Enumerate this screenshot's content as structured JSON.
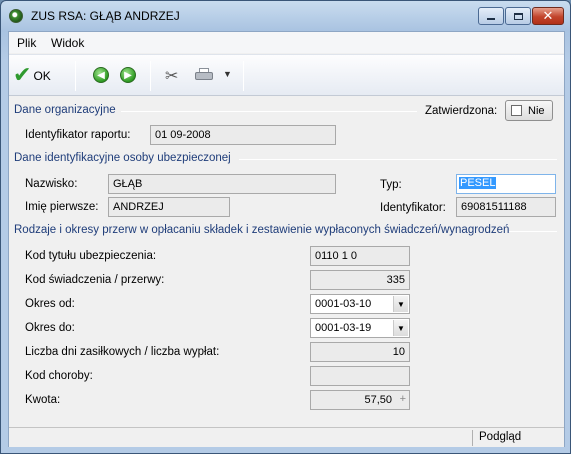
{
  "window": {
    "title": "ZUS RSA: GŁĄB ANDRZEJ",
    "icon": "app-icon",
    "controls": [
      "minimize-icon",
      "maximize-icon",
      "close-icon"
    ]
  },
  "menu": {
    "items": [
      "Plik",
      "Widok"
    ]
  },
  "toolbar": {
    "ok_label": "OK",
    "icons": [
      "ok-check-icon",
      "back-arrow-icon",
      "forward-arrow-icon",
      "tools-icon",
      "print-icon",
      "dropdown-arrow-icon"
    ]
  },
  "org_section": {
    "title": "Dane organizacyjne",
    "approved_label": "Zatwierdzona:",
    "approved_value": "Nie",
    "report_id_label": "Identyfikator raportu:",
    "report_id_value": "01 09-2008"
  },
  "person_section": {
    "title": "Dane identyfikacyjne osoby ubezpieczonej",
    "surname_label": "Nazwisko:",
    "surname_value": "GŁĄB",
    "firstname_label": "Imię pierwsze:",
    "firstname_value": "ANDRZEJ",
    "type_label": "Typ:",
    "type_value": "PESEL",
    "identifier_label": "Identyfikator:",
    "identifier_value": "69081511188"
  },
  "breaks_section": {
    "title": "Rodzaje i okresy przerw w opłacaniu składek i zestawienie wypłaconych świadczeń/wynagrodzeń",
    "insurance_code_label": "Kod tytułu ubezpieczenia:",
    "insurance_code_value": "0110 1 0",
    "benefit_code_label": "Kod świadczenia / przerwy:",
    "benefit_code_value": "335",
    "period_from_label": "Okres od:",
    "period_from_value": "0001-03-10",
    "period_to_label": "Okres do:",
    "period_to_value": "0001-03-19",
    "days_label": "Liczba dni zasiłkowych / liczba wypłat:",
    "days_value": "10",
    "illness_code_label": "Kod choroby:",
    "illness_code_value": "",
    "amount_label": "Kwota:",
    "amount_value": "57,50"
  },
  "statusbar": {
    "preview_label": "Podgląd"
  }
}
